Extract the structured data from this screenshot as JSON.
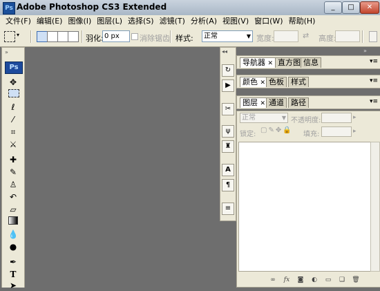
{
  "window": {
    "title": "Adobe Photoshop CS3 Extended",
    "app_icon": "Ps",
    "buttons": [
      "_",
      "□",
      "✕"
    ]
  },
  "menu": [
    "文件(F)",
    "编辑(E)",
    "图像(I)",
    "图层(L)",
    "选择(S)",
    "滤镜(T)",
    "分析(A)",
    "视图(V)",
    "窗口(W)",
    "帮助(H)"
  ],
  "options": {
    "feather_label": "羽化:",
    "feather_value": "0 px",
    "antialias_label": "消除锯齿",
    "style_label": "样式:",
    "style_value": "正常",
    "width_label": "宽度:",
    "height_label": "高度:"
  },
  "tools": {
    "logo": "Ps"
  },
  "panels": {
    "nav_tabs": [
      "导航器",
      "直方图",
      "信息"
    ],
    "color_tabs": [
      "颜色",
      "色板",
      "样式"
    ],
    "layer_tabs": [
      "图层",
      "通道",
      "路径"
    ],
    "blend_mode": "正常",
    "opacity_label": "不透明度:",
    "lock_label": "锁定:",
    "fill_label": "填充:"
  },
  "colors": {
    "workspace": "#6e6e6e",
    "chrome": "#ece9d8",
    "ps_blue": "#1d4a9c"
  }
}
